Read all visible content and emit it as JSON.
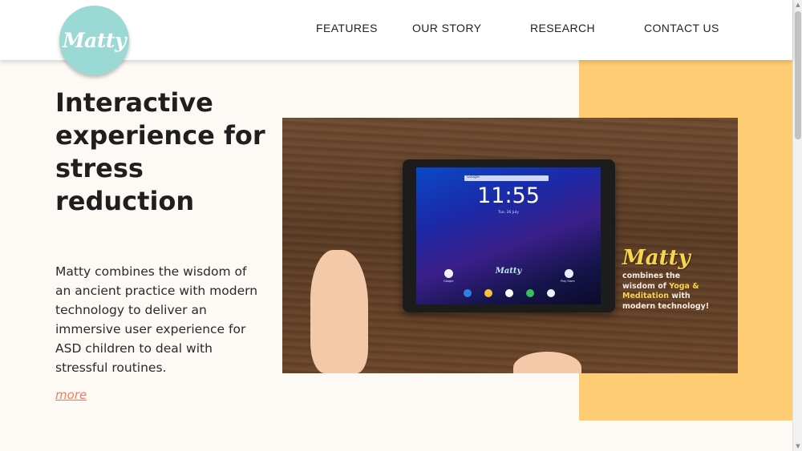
{
  "header": {
    "logo_text": "Matty",
    "nav": [
      {
        "label": "FEATURES"
      },
      {
        "label": "OUR STORY"
      },
      {
        "label": "RESEARCH"
      },
      {
        "label": "CONTACT US"
      }
    ]
  },
  "hero": {
    "headline": "Interactive experience for stress reduction",
    "description": "Matty combines the wisdom of an ancient practice with modern technology to deliver an immersive user experience for ASD children to deal with stressful routines.",
    "more_link": "more"
  },
  "hero_image": {
    "tablet_screen": {
      "search_label": "Google",
      "clock": "11:55",
      "date": "Tue, 26 July",
      "center_logo": "Matty",
      "apps": [
        {
          "label": "Google"
        },
        {
          "label": "Play Store"
        }
      ]
    },
    "promo": {
      "logo": "Matty",
      "line1": "combines the",
      "line2_prefix": "wisdom of ",
      "line2_highlight": "Yoga &",
      "line3_highlight": "Meditation",
      "line3_suffix": " with",
      "line4": "modern technology!"
    }
  },
  "colors": {
    "accent_teal": "#9bd9d5",
    "accent_yellow": "#fecc73",
    "link_coral": "#f07c5a",
    "page_bg": "#fdfaf6"
  }
}
